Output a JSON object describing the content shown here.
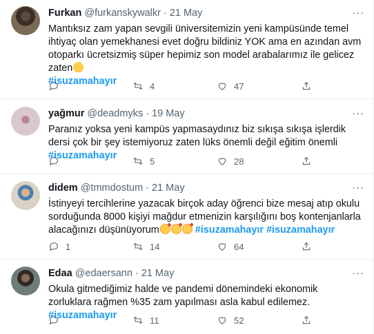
{
  "tweets": [
    {
      "name": "Furkan",
      "handle": "@furkanskywalkr",
      "separator": "·",
      "date": "21 May",
      "text_before": "Mantıksız zam yapan sevgili üniversitemizin yeni kampüsünde temel ihtiyaç olan yemekhanesi evet doğru bildiniz YOK ama en azından avm otoparkı ücretsizmiş süper hepimiz son model arabalarımız ile gelicez zaten",
      "emoji": [
        "smile"
      ],
      "hashtag": "#isuzamahayır",
      "replies": "",
      "retweets": "4",
      "likes": "47"
    },
    {
      "name": "yağmur",
      "handle": "@deadmyks",
      "separator": "·",
      "date": "19 May",
      "text_before": "Paranız yoksa yeni kampüs yapmasaydınız biz sıkışa sıkışa işlerdik dersi çok bir şey istemiyoruz zaten lüks önemli değil eğitim önemli",
      "emoji": [],
      "hashtag": "#isuzamahayır",
      "replies": "",
      "retweets": "5",
      "likes": "28"
    },
    {
      "name": "didem",
      "handle": "@tmmdostum",
      "separator": "·",
      "date": "21 May",
      "text_before": "İstinyeyi tercihlerine yazacak birçok aday öğrenci bize mesaj atıp okulu sorduğunda 8000 kişiyi mağdur etmenizin karşılığını boş kontenjanlarla alacağınızı düşünüyorum",
      "emoji": [
        "love",
        "love",
        "love"
      ],
      "extra": "#isuzamahayır",
      "hashtag": "#isuzamahayır",
      "replies": "1",
      "retweets": "14",
      "likes": "64"
    },
    {
      "name": "Edaa",
      "handle": "@edaersann",
      "separator": "·",
      "date": "21 May",
      "text_before": "Okula gitmediğimiz halde ve pandemi dönemindeki ekonomik zorluklara rağmen %35 zam yapılması asla kabul edilemez.",
      "emoji": [],
      "hashtag": "#isuzamahayır",
      "replies": "",
      "retweets": "11",
      "likes": "52"
    }
  ],
  "icons": {
    "reply": "reply-icon",
    "retweet": "retweet-icon",
    "like": "heart-icon",
    "share": "share-icon",
    "more": "more-icon"
  },
  "colors": {
    "hashtag": "#1d9bf0",
    "secondary": "#536471",
    "divider": "#ebeef0"
  }
}
